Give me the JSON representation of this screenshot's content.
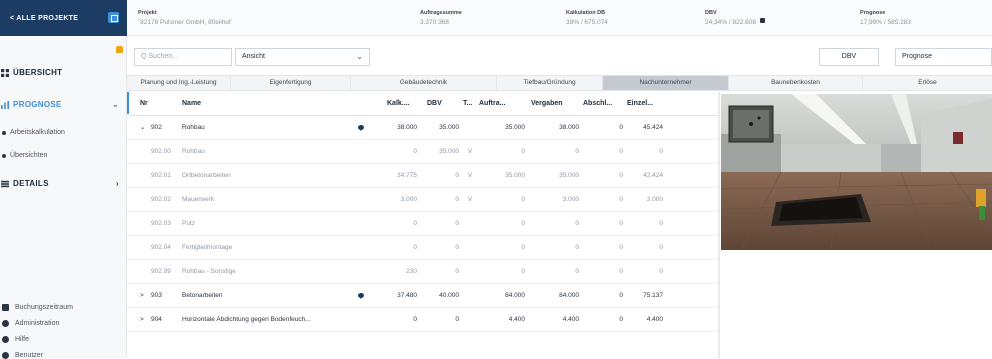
{
  "header": {
    "back_label": "< ALLE PROJEKTE",
    "project_label": "Projekt",
    "project_value": "ˆ82178 Pulsmer GmbH, 80eiihof",
    "auftrag_label": "Auftragssumme",
    "auftrag_value": "3.370.368",
    "kalk_label": "Kalkulation DB",
    "kalk_value": "39% / 675.074",
    "dbv_label": "DBV",
    "dbv_value": "24,34% / 822.608",
    "prognose_label": "Prognose",
    "prognose_value": "17,99% / 585.283"
  },
  "sidebar": {
    "overview": "ÜBERSICHT",
    "prognose": "PROGNOSE",
    "sub_items": [
      "Arbeitskalkulation",
      "Übersichten"
    ],
    "details": "DETAILS",
    "footer": [
      "Buchungszeitraum",
      "Administration",
      "Hilfe",
      "Benutzer"
    ]
  },
  "toolbar": {
    "search_placeholder": "Q Suchen...",
    "view_label": "Ansicht",
    "dbv_button": "DBV",
    "prognose_button": "Prognose"
  },
  "tabs": [
    "Planung und Ing.-Leistung",
    "Eigenfertigung",
    "Gebäudetechnik",
    "Tiefbau/Gründung",
    "Nachunternehmer",
    "Baunebenkosten",
    "Erlöse"
  ],
  "table": {
    "columns": [
      "Nr",
      "Name",
      "Kalk....",
      "DBV",
      "T...",
      "Auftra...",
      "Vergaben",
      "Abschl...",
      "Einzel..."
    ],
    "rows": [
      {
        "expand": "⌄",
        "nr": "902",
        "name": "Rohbau",
        "comment": true,
        "kalk": "38.000",
        "dbv": "35.000",
        "t": "",
        "auftr": "35.000",
        "verg": "38.000",
        "absch": "0",
        "einz": "45.424"
      },
      {
        "expand": "",
        "nr": "902.00",
        "name": "Rohbau",
        "comment": false,
        "kalk": "0",
        "dbv": "35.000",
        "t": "V",
        "auftr": "0",
        "verg": "0",
        "absch": "0",
        "einz": "0"
      },
      {
        "expand": "",
        "nr": "902.01",
        "name": "Ortbetonarbeiten",
        "comment": false,
        "kalk": "34.775",
        "dbv": "0",
        "t": "V",
        "auftr": "35.000",
        "verg": "35.000",
        "absch": "0",
        "einz": "42.424"
      },
      {
        "expand": "",
        "nr": "902.02",
        "name": "Mauerwerk",
        "comment": false,
        "kalk": "3.000",
        "dbv": "0",
        "t": "V",
        "auftr": "0",
        "verg": "3.000",
        "absch": "0",
        "einz": "3.000"
      },
      {
        "expand": "",
        "nr": "902.03",
        "name": "Putz",
        "comment": false,
        "kalk": "0",
        "dbv": "0",
        "t": "",
        "auftr": "0",
        "verg": "0",
        "absch": "0",
        "einz": "0"
      },
      {
        "expand": "",
        "nr": "902.04",
        "name": "Fertigteilmontage",
        "comment": false,
        "kalk": "0",
        "dbv": "0",
        "t": "",
        "auftr": "0",
        "verg": "0",
        "absch": "0",
        "einz": "0"
      },
      {
        "expand": "",
        "nr": "902.99",
        "name": "Rohbau - Sonstige",
        "comment": false,
        "kalk": "230",
        "dbv": "0",
        "t": "",
        "auftr": "0",
        "verg": "0",
        "absch": "0",
        "einz": "0"
      },
      {
        "expand": ">",
        "nr": "903",
        "name": "Betonarbeiten",
        "comment": true,
        "kalk": "37.480",
        "dbv": "40.000",
        "t": "",
        "auftr": "84.000",
        "verg": "84.000",
        "absch": "0",
        "einz": "75.137"
      },
      {
        "expand": ">",
        "nr": "904",
        "name": "Horizontale Abdichtung gegen Bodenfeuch...",
        "comment": false,
        "kalk": "0",
        "dbv": "0",
        "t": "",
        "auftr": "4.400",
        "verg": "4.400",
        "absch": "0",
        "einz": "4.400"
      }
    ]
  },
  "colors": {
    "brand_dark": "#1d3c64",
    "accent": "#3f8fd8",
    "warning": "#f0a419"
  }
}
